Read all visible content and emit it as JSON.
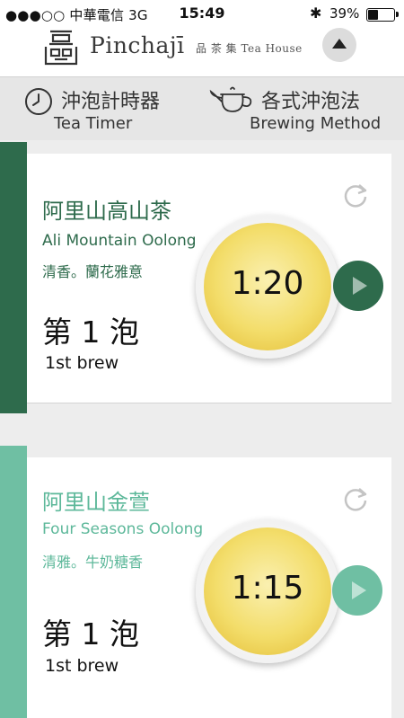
{
  "status_bar": {
    "carrier": "●●●○○ 中華電信  3G",
    "time": "15:49",
    "bluetooth_icon": "bluetooth-icon",
    "battery_percent": "39%",
    "battery_level": 0.39
  },
  "header": {
    "brand_name": "Pinchajī",
    "brand_subtitle": "品 茶 集  Tea House",
    "logo_icon": "pinchaji-logo",
    "collapse_icon": "triangle-up-icon"
  },
  "nav": {
    "timer": {
      "label_zh": "沖泡計時器",
      "label_en": "Tea Timer",
      "icon": "clock-icon"
    },
    "brewing": {
      "label_zh": "各式沖泡法",
      "label_en": "Brewing Method",
      "icon": "teapot-icon"
    }
  },
  "teas": [
    {
      "name_zh": "阿里山高山茶",
      "name_en": "Ali Mountain Oolong",
      "description": "清香。蘭花雅意",
      "brew_zh": "第 1 泡",
      "brew_en": "1st brew",
      "timer": "1:20",
      "accent_color": "#2e6b4c",
      "text_color": "#2e6b4c"
    },
    {
      "name_zh": "阿里山金萱",
      "name_en": "Four Seasons Oolong",
      "description": "清雅。牛奶糖香",
      "brew_zh": "第 1 泡",
      "brew_en": "1st brew",
      "timer": "1:15",
      "accent_color": "#6fbfa3",
      "text_color": "#5db89a"
    }
  ]
}
